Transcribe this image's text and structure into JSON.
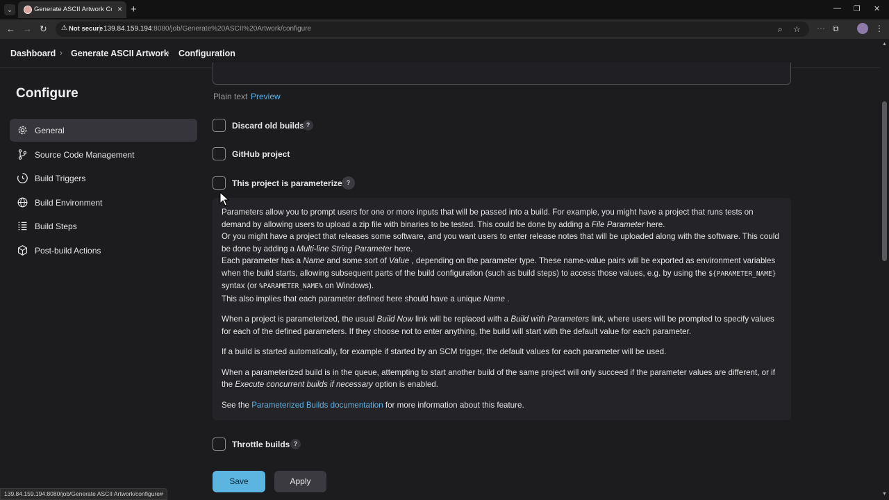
{
  "browser": {
    "tab_title": "Generate ASCII Artwork Config",
    "security_label": "Not secure",
    "url_host": "139.84.159.194",
    "url_path": ":8080/job/Generate%20ASCII%20Artwork/configure",
    "status_url": "139.84.159.194:8080/job/Generate ASCII Artwork/configure#"
  },
  "breadcrumbs": [
    "Dashboard",
    "Generate ASCII Artwork",
    "Configuration"
  ],
  "sidebar": {
    "title": "Configure",
    "items": [
      {
        "label": "General",
        "icon": "gear-icon",
        "active": true
      },
      {
        "label": "Source Code Management",
        "icon": "branch-icon",
        "active": false
      },
      {
        "label": "Build Triggers",
        "icon": "clock-icon",
        "active": false
      },
      {
        "label": "Build Environment",
        "icon": "globe-icon",
        "active": false
      },
      {
        "label": "Build Steps",
        "icon": "list-icon",
        "active": false
      },
      {
        "label": "Post-build Actions",
        "icon": "package-icon",
        "active": false
      }
    ]
  },
  "description": {
    "plain_text_label": "Plain text",
    "preview_link": "Preview"
  },
  "options": {
    "discard_old_builds": {
      "label": "Discard old builds",
      "checked": false,
      "help": "?"
    },
    "github_project": {
      "label": "GitHub project",
      "checked": false
    },
    "parameterized": {
      "label": "This project is parameterized",
      "checked": false,
      "help": "?"
    },
    "throttle_builds": {
      "label": "Throttle builds",
      "checked": false,
      "help": "?"
    }
  },
  "help": {
    "p1_a": "Parameters allow you to prompt users for one or more inputs that will be passed into a build. For example, you might have a project that runs tests on demand by allowing users to upload a zip file with binaries to be tested. This could be done by adding a ",
    "p1_em": "File Parameter",
    "p1_b": " here.",
    "p2_a": "Or you might have a project that releases some software, and you want users to enter release notes that will be uploaded along with the software. This could be done by adding a ",
    "p2_em": "Multi-line String Parameter",
    "p2_b": " here.",
    "p3_a": "Each parameter has a ",
    "p3_em1": "Name",
    "p3_b": " and some sort of ",
    "p3_em2": "Value",
    "p3_c": " , depending on the parameter type. These name-value pairs will be exported as environment variables when the build starts, allowing subsequent parts of the build configuration (such as build steps) to access those values, e.g. by using the ",
    "p3_code1": "${PARAMETER_NAME}",
    "p3_d": " syntax (or ",
    "p3_code2": "%PARAMETER_NAME%",
    "p3_e": " on Windows).",
    "p4_a": "This also implies that each parameter defined here should have a unique ",
    "p4_em": "Name",
    "p4_b": " .",
    "p5_a": "When a project is parameterized, the usual ",
    "p5_em1": "Build Now",
    "p5_b": " link will be replaced with a ",
    "p5_em2": "Build with Parameters",
    "p5_c": " link, where users will be prompted to specify values for each of the defined parameters. If they choose not to enter anything, the build will start with the default value for each parameter.",
    "p6": "If a build is started automatically, for example if started by an SCM trigger, the default values for each parameter will be used.",
    "p7_a": "When a parameterized build is in the queue, attempting to start another build of the same project will only succeed if the parameter values are different, or if the ",
    "p7_em": "Execute concurrent builds if necessary",
    "p7_b": " option is enabled.",
    "p8_a": "See the ",
    "p8_link": "Parameterized Builds documentation",
    "p8_b": " for more information about this feature."
  },
  "actions": {
    "save": "Save",
    "apply": "Apply"
  },
  "colors": {
    "accent": "#5bb5e0",
    "link": "#5db3e8",
    "background": "#1c1c1f"
  }
}
